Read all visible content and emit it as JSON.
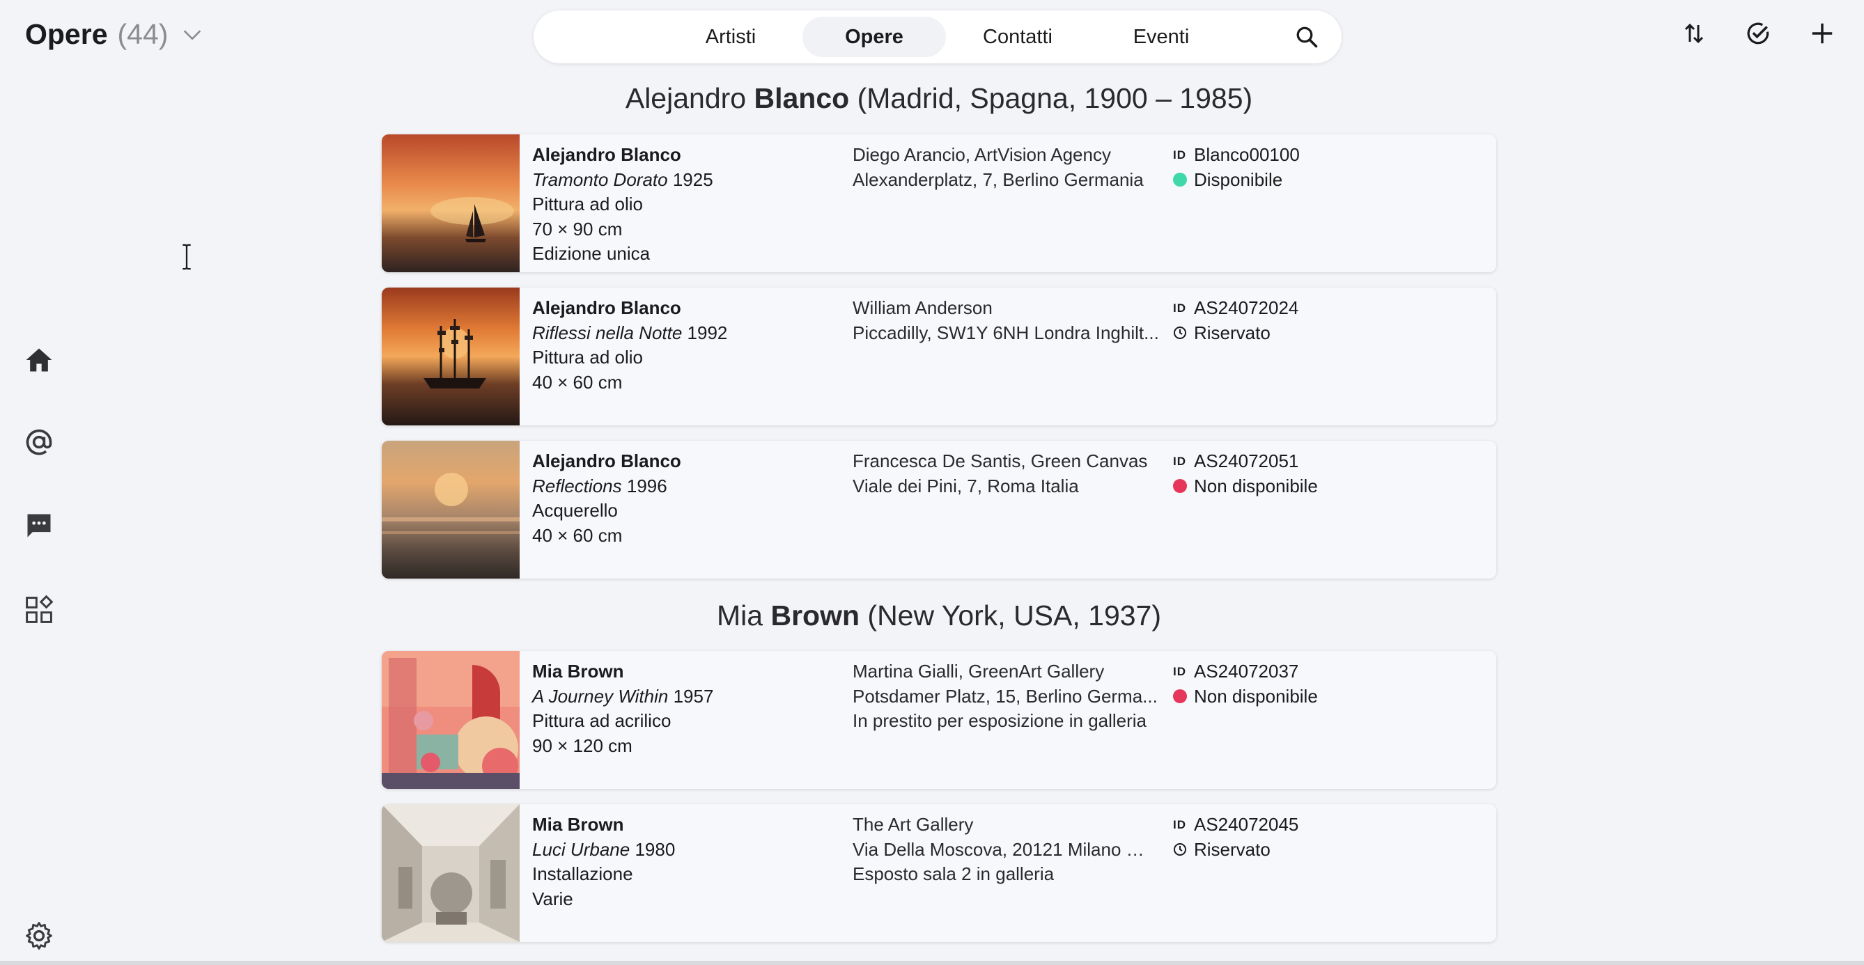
{
  "header": {
    "title": "Opere",
    "count": "(44)"
  },
  "nav": {
    "tabs": [
      "Artisti",
      "Opere",
      "Contatti",
      "Eventi"
    ],
    "active": "Opere"
  },
  "colors": {
    "available": "#3fd8a8",
    "unavailable": "#e6365a",
    "background": "#f3f4f7"
  },
  "groups": [
    {
      "first_name": "Alejandro",
      "last_name": "Blanco",
      "details": "(Madrid, Spagna, 1900 – 1985)",
      "works": [
        {
          "artist": "Alejandro Blanco",
          "title": "Tramonto Dorato",
          "year": "1925",
          "medium": "Pittura ad olio",
          "size": "70 × 90 cm",
          "edition": "Edizione unica",
          "owner": "Diego Arancio, ArtVision Agency",
          "address": "Alexanderplatz, 7, Berlino Germania",
          "note": "",
          "id": "Blanco00100",
          "status": "Disponibile",
          "status_type": "available"
        },
        {
          "artist": "Alejandro Blanco",
          "title": "Riflessi nella Notte",
          "year": "1992",
          "medium": "Pittura ad olio",
          "size": "40 × 60 cm",
          "edition": "",
          "owner": "William Anderson",
          "address": "Piccadilly, SW1Y 6NH Londra Inghilt...",
          "note": "",
          "id": "AS24072024",
          "status": "Riservato",
          "status_type": "reserved"
        },
        {
          "artist": "Alejandro Blanco",
          "title": "Reflections",
          "year": "1996",
          "medium": "Acquerello",
          "size": "40 × 60 cm",
          "edition": "",
          "owner": "Francesca De Santis, Green Canvas",
          "address": "Viale dei Pini, 7, Roma Italia",
          "note": "",
          "id": "AS24072051",
          "status": "Non disponibile",
          "status_type": "unavailable"
        }
      ]
    },
    {
      "first_name": "Mia",
      "last_name": "Brown",
      "details": "(New York, USA, 1937)",
      "works": [
        {
          "artist": "Mia Brown",
          "title": "A Journey Within",
          "year": "1957",
          "medium": "Pittura ad acrilico",
          "size": "90 × 120 cm",
          "edition": "",
          "owner": "Martina Gialli, GreenArt Gallery",
          "address": "Potsdamer Platz, 15, Berlino Germa...",
          "note": "In prestito per esposizione in galleria",
          "id": "AS24072037",
          "status": "Non disponibile",
          "status_type": "unavailable"
        },
        {
          "artist": "Mia Brown",
          "title": "Luci Urbane",
          "year": "1980",
          "medium": "Installazione",
          "size": "Varie",
          "edition": "",
          "owner": "The Art Gallery",
          "address": "Via Della Moscova, 20121 Milano MI...",
          "note": "Esposto sala 2 in galleria",
          "id": "AS24072045",
          "status": "Riservato",
          "status_type": "reserved"
        }
      ]
    }
  ]
}
